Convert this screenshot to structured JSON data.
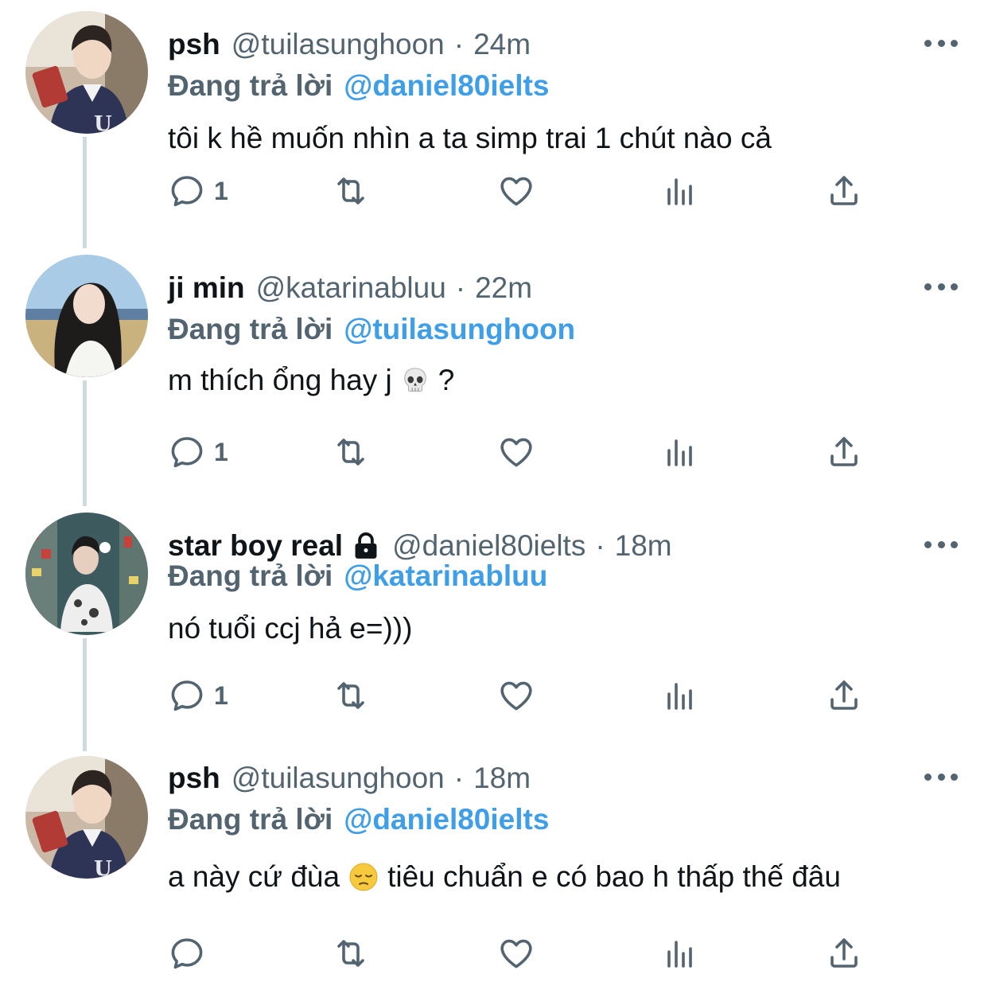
{
  "tweets": [
    {
      "name": "psh",
      "handle": "@tuilasunghoon",
      "separator": "·",
      "time": "24m",
      "reply_prefix": "Đang trả lời",
      "reply_to": "@daniel80ielts",
      "text": "tôi k hề muốn nhìn a ta simp trai 1 chút nào cả",
      "reply_count": "1",
      "avatar": "avatar-boy-reading"
    },
    {
      "name": "ji min",
      "handle": "@katarinabluu",
      "separator": "·",
      "time": "22m",
      "reply_prefix": "Đang trả lời",
      "reply_to": "@tuilasunghoon",
      "text_before": "m thích ổng hay j",
      "emoji": "skull",
      "text_after": "?",
      "reply_count": "1",
      "avatar": "avatar-girl-beach"
    },
    {
      "name": "star boy real",
      "locked": true,
      "handle": "@daniel80ielts",
      "separator": "·",
      "time": "18m",
      "reply_prefix": "Đang trả lời",
      "reply_to": "@katarinabluu",
      "text": "nó tuổi ccj hả e=)))",
      "reply_count": "1",
      "avatar": "avatar-mirror-selfie"
    },
    {
      "name": "psh",
      "handle": "@tuilasunghoon",
      "separator": "·",
      "time": "18m",
      "reply_prefix": "Đang trả lời",
      "reply_to": "@daniel80ielts",
      "text_before": "a này cứ đùa",
      "emoji": "pensive-face",
      "text_after": "tiêu chuẩn e có bao h thấp thế đâu",
      "reply_count": "",
      "avatar": "avatar-boy-reading"
    }
  ],
  "icons": [
    "reply-icon",
    "retweet-icon",
    "like-icon",
    "views-icon",
    "share-icon",
    "more-icon",
    "lock-icon"
  ],
  "colors": {
    "text": "#0f1419",
    "secondary": "#536471",
    "link": "#3e9ee8",
    "thread_line": "#cfd9de"
  }
}
